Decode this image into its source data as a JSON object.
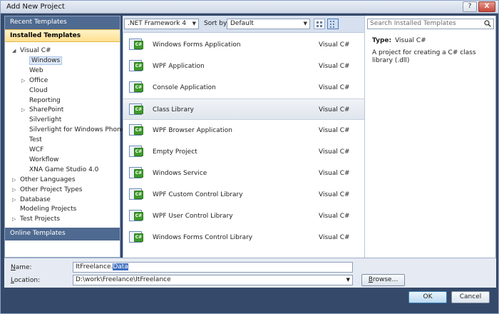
{
  "window": {
    "title": "Add New Project",
    "help_label": "?",
    "close_label": "X"
  },
  "left_pane": {
    "recent_templates": "Recent Templates",
    "installed_templates": "Installed Templates",
    "online_templates": "Online Templates",
    "tree": [
      {
        "label": "Visual C#",
        "arrow": "◢"
      },
      {
        "label": "Windows"
      },
      {
        "label": "Web"
      },
      {
        "label": "Office",
        "arrow": "▷"
      },
      {
        "label": "Cloud"
      },
      {
        "label": "Reporting"
      },
      {
        "label": "SharePoint",
        "arrow": "▷"
      },
      {
        "label": "Silverlight"
      },
      {
        "label": "Silverlight for Windows Phone"
      },
      {
        "label": "Test"
      },
      {
        "label": "WCF"
      },
      {
        "label": "Workflow"
      },
      {
        "label": "XNA Game Studio 4.0"
      },
      {
        "label": "Other Languages",
        "arrow": "▷"
      },
      {
        "label": "Other Project Types",
        "arrow": "▷"
      },
      {
        "label": "Database",
        "arrow": "▷"
      },
      {
        "label": "Modeling Projects"
      },
      {
        "label": "Test Projects",
        "arrow": "▷"
      }
    ],
    "selected_item": "Windows"
  },
  "toolbar": {
    "framework": ".NET Framework 4",
    "sort_label": "Sort by:",
    "sort_value": "Default",
    "chevron": "▼"
  },
  "templates": [
    {
      "name": "Windows Forms Application",
      "language": "Visual C#"
    },
    {
      "name": "WPF Application",
      "language": "Visual C#"
    },
    {
      "name": "Console Application",
      "language": "Visual C#"
    },
    {
      "name": "Class Library",
      "language": "Visual C#"
    },
    {
      "name": "WPF Browser Application",
      "language": "Visual C#"
    },
    {
      "name": "Empty Project",
      "language": "Visual C#"
    },
    {
      "name": "Windows Service",
      "language": "Visual C#"
    },
    {
      "name": "WPF Custom Control Library",
      "language": "Visual C#"
    },
    {
      "name": "WPF User Control Library",
      "language": "Visual C#"
    },
    {
      "name": "Windows Forms Control Library",
      "language": "Visual C#"
    }
  ],
  "selected_template": "Class Library",
  "template_icon_text": "C#",
  "right_pane": {
    "search_placeholder": "Search Installed Templates",
    "type_label": "Type:",
    "type_value": "Visual C#",
    "description": "A project for creating a C# class library (.dll)"
  },
  "form": {
    "name_label_underlined": "N",
    "name_label_rest": "ame:",
    "name_value_plain": "ItFreelance.",
    "name_value_selected": "Data",
    "location_label_underlined": "L",
    "location_label_rest": "ocation:",
    "location_value": "D:\\work\\Freelance\\ItFreelance",
    "browse_label_underlined": "B",
    "browse_label_rest": "rowse..."
  },
  "footer": {
    "ok_label": "OK",
    "cancel_label": "Cancel"
  },
  "colors": {
    "frame": "#35496a",
    "section_header": "#4f6a90",
    "installed_highlight": "#ffe08f",
    "cs_icon_green": "#3f9b2c"
  }
}
